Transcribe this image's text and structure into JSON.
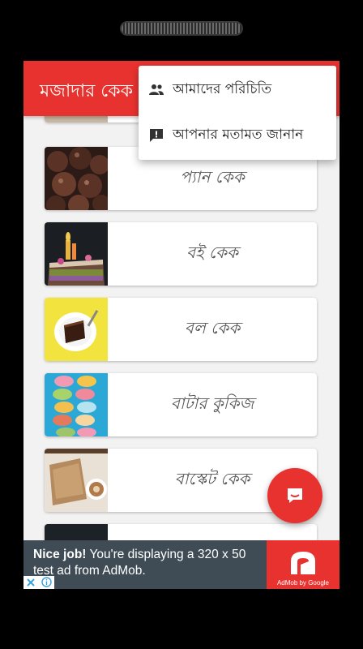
{
  "app": {
    "title": "মজাদার কেক",
    "accent_color": "#e8322f"
  },
  "overflow_menu": {
    "items": [
      {
        "label": "আমাদের পরিচিতি",
        "icon": "people-icon"
      },
      {
        "label": "আপনার মতামত জানান",
        "icon": "feedback-icon"
      }
    ]
  },
  "recipes": [
    {
      "label": "প্যান কেক",
      "image": "chocolate-cupcakes-image"
    },
    {
      "label": "বই কেক",
      "image": "birthday-cake-image"
    },
    {
      "label": "বল কেক",
      "image": "cake-slice-plate-image"
    },
    {
      "label": "বাটার কুকিজ",
      "image": "macarons-image"
    },
    {
      "label": "বাস্কেট কেক",
      "image": "pastry-coffee-image"
    }
  ],
  "fab": {
    "icon": "chat-icon"
  },
  "ad": {
    "headline": "Nice job!",
    "body": " You're displaying a 320 x 50 test ad from AdMob.",
    "brand": "AdMob by Google"
  }
}
